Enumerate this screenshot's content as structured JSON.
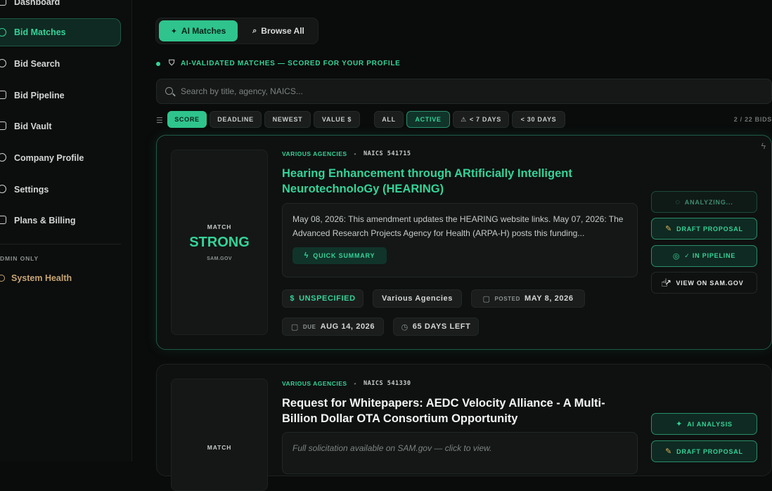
{
  "sidebar": {
    "items": [
      {
        "label": "Dashboard",
        "icon": "dashboard-icon"
      },
      {
        "label": "Bid Matches",
        "icon": "target-icon",
        "active": true
      },
      {
        "label": "Bid Search",
        "icon": "search-icon"
      },
      {
        "label": "Bid Pipeline",
        "icon": "pipeline-icon"
      },
      {
        "label": "Bid Vault",
        "icon": "vault-icon"
      },
      {
        "label": "Company Profile",
        "icon": "user-icon"
      },
      {
        "label": "Settings",
        "icon": "gear-icon"
      },
      {
        "label": "Plans & Billing",
        "icon": "billing-icon"
      }
    ],
    "admin_label": "DMIN ONLY",
    "system_health": "System Health"
  },
  "top_tabs": {
    "ai_matches": "AI Matches",
    "browse_all": "Browse All"
  },
  "section_heading": "AI-VALIDATED MATCHES — SCORED FOR YOUR PROFILE",
  "search": {
    "placeholder": "Search by title, agency, NAICS..."
  },
  "filters": {
    "sort": [
      "SCORE",
      "DEADLINE",
      "NEWEST",
      "VALUE $"
    ],
    "status": [
      "ALL",
      "ACTIVE",
      "< 7 DAYS",
      "< 30 DAYS"
    ],
    "count": "2 / 22 BIDS"
  },
  "cards": [
    {
      "match_label": "MATCH",
      "match_value": "STRONG",
      "match_source": "SAM.GOV",
      "agency": "VARIOUS AGENCIES",
      "naics": "NAICS 541715",
      "title": "Hearing Enhancement through ARtificially Intelligent NeurotechnoloGy (HEARING)",
      "description": "May 08, 2026: This amendment updates the HEARING website links. May 07, 2026: The Advanced Research Projects Agency for Health (ARPA-H) posts this funding...",
      "quick_summary": "QUICK SUMMARY",
      "value_tag": "UNSPECIFIED",
      "agency_tag": "Various Agencies",
      "posted_label": "POSTED",
      "posted_date": "MAY 8, 2026",
      "due_label": "DUE",
      "due_date": "AUG 14, 2026",
      "days_left": "65 DAYS LEFT",
      "actions": {
        "analyzing": "ANALYZING...",
        "draft": "DRAFT PROPOSAL",
        "pipeline": "✓ IN PIPELINE",
        "sam": "VIEW ON SAM.GOV"
      }
    },
    {
      "match_label": "MATCH",
      "agency": "VARIOUS AGENCIES",
      "naics": "NAICS 541330",
      "title": "Request for Whitepapers: AEDC Velocity Alliance - A Multi-Billion Dollar OTA Consortium Opportunity",
      "description": "Full solicitation available on SAM.gov — click to view.",
      "actions": {
        "ai_analysis": "AI ANALYSIS",
        "draft": "DRAFT PROPOSAL"
      }
    }
  ]
}
